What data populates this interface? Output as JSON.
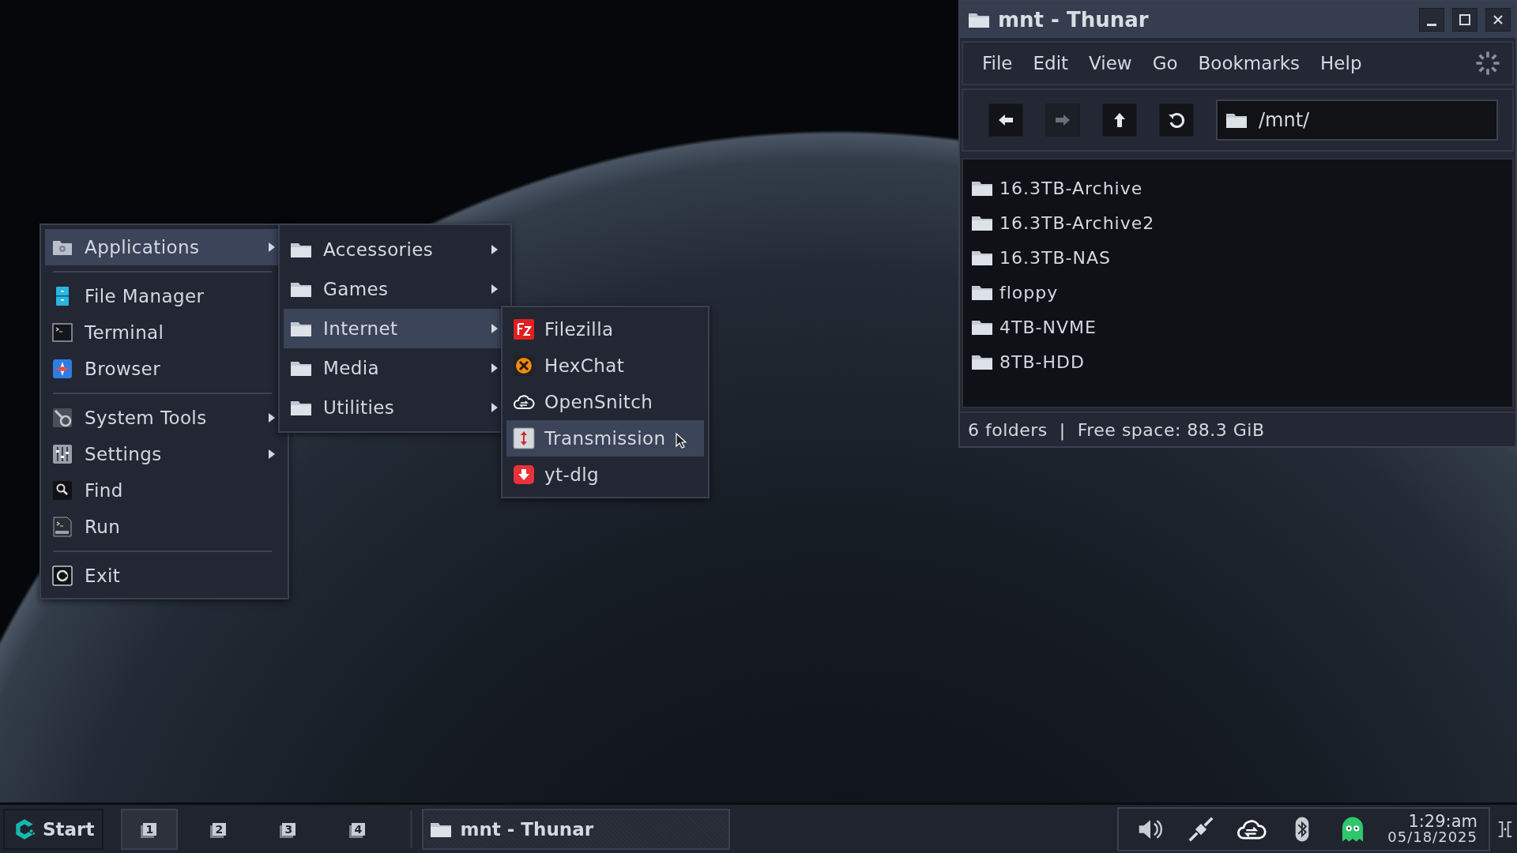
{
  "start_menu": {
    "items": [
      {
        "kind": "item",
        "label": "Applications",
        "submenu": true,
        "selected": true
      },
      {
        "kind": "separator"
      },
      {
        "kind": "item",
        "label": "File Manager",
        "submenu": false,
        "selected": false
      },
      {
        "kind": "item",
        "label": "Terminal",
        "submenu": false,
        "selected": false
      },
      {
        "kind": "item",
        "label": "Browser",
        "submenu": false,
        "selected": false
      },
      {
        "kind": "separator"
      },
      {
        "kind": "item",
        "label": "System Tools",
        "submenu": true,
        "selected": false
      },
      {
        "kind": "item",
        "label": "Settings",
        "submenu": true,
        "selected": false
      },
      {
        "kind": "item",
        "label": "Find",
        "submenu": false,
        "selected": false
      },
      {
        "kind": "item",
        "label": "Run",
        "submenu": false,
        "selected": false
      },
      {
        "kind": "separator"
      },
      {
        "kind": "item",
        "label": "Exit",
        "submenu": false,
        "selected": false
      }
    ]
  },
  "categories_menu": {
    "items": [
      {
        "label": "Accessories",
        "submenu": true,
        "selected": false
      },
      {
        "label": "Games",
        "submenu": true,
        "selected": false
      },
      {
        "label": "Internet",
        "submenu": true,
        "selected": true
      },
      {
        "label": "Media",
        "submenu": true,
        "selected": false
      },
      {
        "label": "Utilities",
        "submenu": true,
        "selected": false
      }
    ]
  },
  "internet_menu": {
    "items": [
      {
        "label": "Filezilla",
        "selected": false
      },
      {
        "label": "HexChat",
        "selected": false
      },
      {
        "label": "OpenSnitch",
        "selected": false
      },
      {
        "label": "Transmission",
        "selected": true
      },
      {
        "label": "yt-dlg",
        "selected": false
      }
    ]
  },
  "file_manager": {
    "title": "mnt - Thunar",
    "menubar": [
      "File",
      "Edit",
      "View",
      "Go",
      "Bookmarks",
      "Help"
    ],
    "nav_buttons": [
      {
        "disabled": false
      },
      {
        "disabled": true
      },
      {
        "disabled": false
      },
      {
        "disabled": false
      }
    ],
    "location": "/mnt/",
    "folders": [
      "16.3TB-Archive",
      "16.3TB-Archive2",
      "16.3TB-NAS",
      "floppy",
      "4TB-NVME",
      "8TB-HDD"
    ],
    "status_bar": "6 folders  |  Free space: 88.3 GiB"
  },
  "taskbar": {
    "start_label": "Start",
    "workspaces": [
      {
        "label": "1",
        "selected": true
      },
      {
        "label": "2",
        "selected": false
      },
      {
        "label": "3",
        "selected": false
      },
      {
        "label": "4",
        "selected": false
      }
    ],
    "tasks": [
      {
        "title": "mnt - Thunar",
        "selected": true
      }
    ],
    "clock": {
      "time": "1:29:am",
      "date": "05/18/2025"
    }
  }
}
